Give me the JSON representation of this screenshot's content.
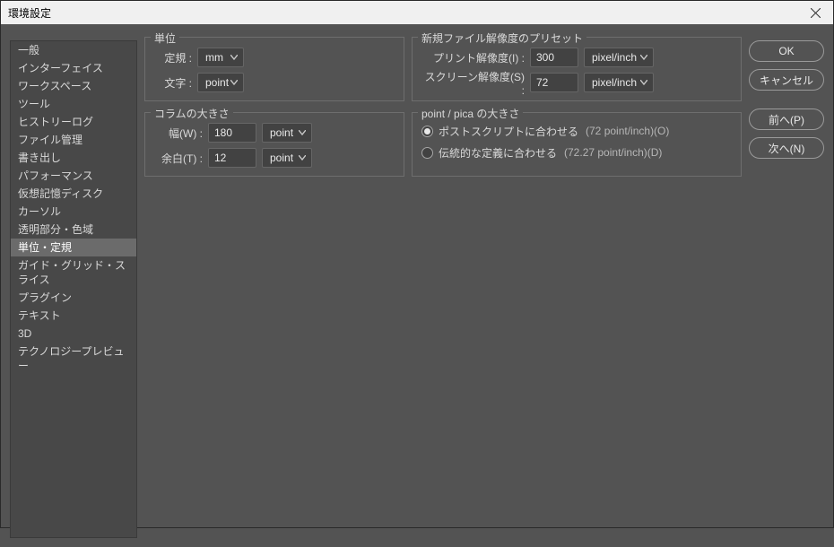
{
  "dialog": {
    "title": "環境設定"
  },
  "sidebar": {
    "items": [
      {
        "label": "一般"
      },
      {
        "label": "インターフェイス"
      },
      {
        "label": "ワークスペース"
      },
      {
        "label": "ツール"
      },
      {
        "label": "ヒストリーログ"
      },
      {
        "label": "ファイル管理"
      },
      {
        "label": "書き出し"
      },
      {
        "label": "パフォーマンス"
      },
      {
        "label": "仮想記憶ディスク"
      },
      {
        "label": "カーソル"
      },
      {
        "label": "透明部分・色域"
      },
      {
        "label": "単位・定規"
      },
      {
        "label": "ガイド・グリッド・スライス"
      },
      {
        "label": "プラグイン"
      },
      {
        "label": "テキスト"
      },
      {
        "label": "3D"
      },
      {
        "label": "テクノロジープレビュー"
      }
    ]
  },
  "units": {
    "legend": "単位",
    "ruler_label": "定規 :",
    "ruler_value": "mm",
    "type_label": "文字 :",
    "type_value": "point"
  },
  "preset": {
    "legend": "新規ファイル解像度のプリセット",
    "print_label": "プリント解像度(I) :",
    "print_value": "300",
    "print_unit": "pixel/inch",
    "screen_label": "スクリーン解像度(S) :",
    "screen_value": "72",
    "screen_unit": "pixel/inch"
  },
  "column": {
    "legend": "コラムの大きさ",
    "width_label": "幅(W) :",
    "width_value": "180",
    "width_unit": "point",
    "gutter_label": "余白(T) :",
    "gutter_value": "12",
    "gutter_unit": "point"
  },
  "pointpica": {
    "legend": "point / pica の大きさ",
    "postscript_label": "ポストスクリプトに合わせる",
    "postscript_sub": "(72 point/inch)(O)",
    "traditional_label": "伝統的な定義に合わせる",
    "traditional_sub": "(72.27 point/inch)(D)"
  },
  "buttons": {
    "ok": "OK",
    "cancel": "キャンセル",
    "prev": "前へ(P)",
    "next": "次へ(N)"
  }
}
